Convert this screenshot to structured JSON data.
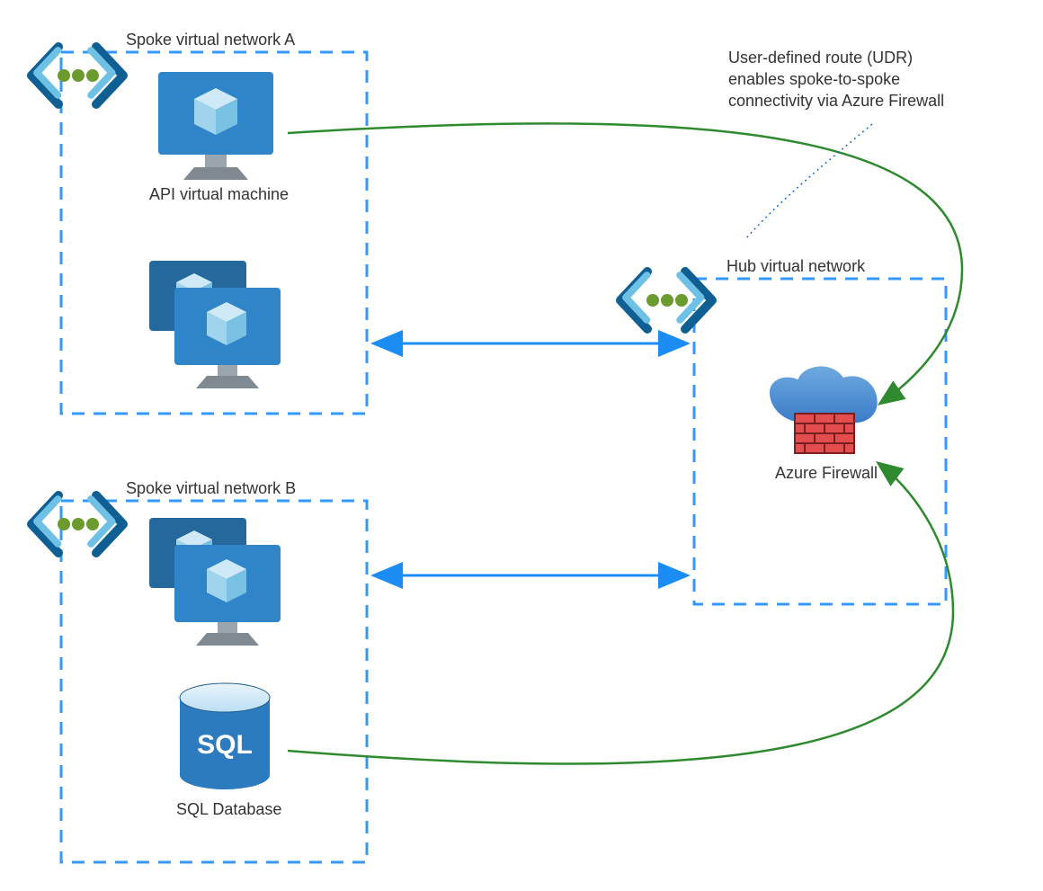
{
  "spokeA": {
    "title": "Spoke virtual network A",
    "apiVm": "API virtual machine"
  },
  "spokeB": {
    "title": "Spoke virtual network B",
    "sqlDb": "SQL Database"
  },
  "hub": {
    "title": "Hub virtual network",
    "firewall": "Azure Firewall"
  },
  "annotation": {
    "line1": "User-defined route (UDR)",
    "line2": "enables spoke-to-spoke",
    "line3": "connectivity via Azure Firewall"
  },
  "colors": {
    "dashBlue": "#3399ff",
    "arrowBlue": "#1b8df2",
    "green": "#2f8a2f",
    "dottedBlue": "#0066cc",
    "vmBlue": "#2f85c7",
    "cubeLight": "#9fd4ec",
    "sqlBlue": "#2d7bbf",
    "cloudBlue": "#4d8fd6",
    "brick": "#e44d4d",
    "brickLine": "#7a1f1f",
    "peerDark": "#0f5f93",
    "peerLight": "#6ec1e4",
    "peerDot": "#6b9a2f"
  }
}
